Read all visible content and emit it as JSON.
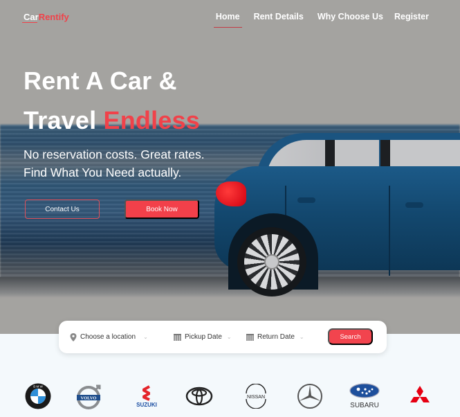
{
  "header": {
    "logo": {
      "part1": "Car",
      "part2": "Rentify"
    },
    "nav": [
      {
        "label": "Home",
        "active": true
      },
      {
        "label": "Rent Details",
        "active": false
      },
      {
        "label": "Why Choose Us",
        "active": false
      },
      {
        "label": "Register",
        "active": false
      }
    ]
  },
  "hero": {
    "title_line1": "Rent A Car &",
    "title_line2_plain": "Travel ",
    "title_line2_accent": "Endless",
    "subtitle_line1": "No reservation costs. Great rates.",
    "subtitle_line2": "Find What You Need actually.",
    "contact_label": "Contact Us",
    "book_label": "Book Now"
  },
  "search": {
    "location_placeholder": "Choose a location",
    "pickup_placeholder": "Pickup Date",
    "return_placeholder": "Return Date",
    "search_label": "Search"
  },
  "brands": [
    {
      "name": "BMW",
      "icon": "bmw-logo-icon"
    },
    {
      "name": "VOLVO",
      "icon": "volvo-logo-icon"
    },
    {
      "name": "SUZUKI",
      "icon": "suzuki-logo-icon"
    },
    {
      "name": "Toyota",
      "icon": "toyota-logo-icon"
    },
    {
      "name": "NISSAN",
      "icon": "nissan-logo-icon"
    },
    {
      "name": "Mercedes",
      "icon": "mercedes-logo-icon"
    },
    {
      "name": "SUBARU",
      "icon": "subaru-logo-icon"
    },
    {
      "name": "Mitsubishi",
      "icon": "mitsubishi-logo-icon"
    }
  ],
  "colors": {
    "accent": "#f0424a",
    "hero_bg": "#a4a3a0",
    "page_bg": "#f4f9fc"
  }
}
